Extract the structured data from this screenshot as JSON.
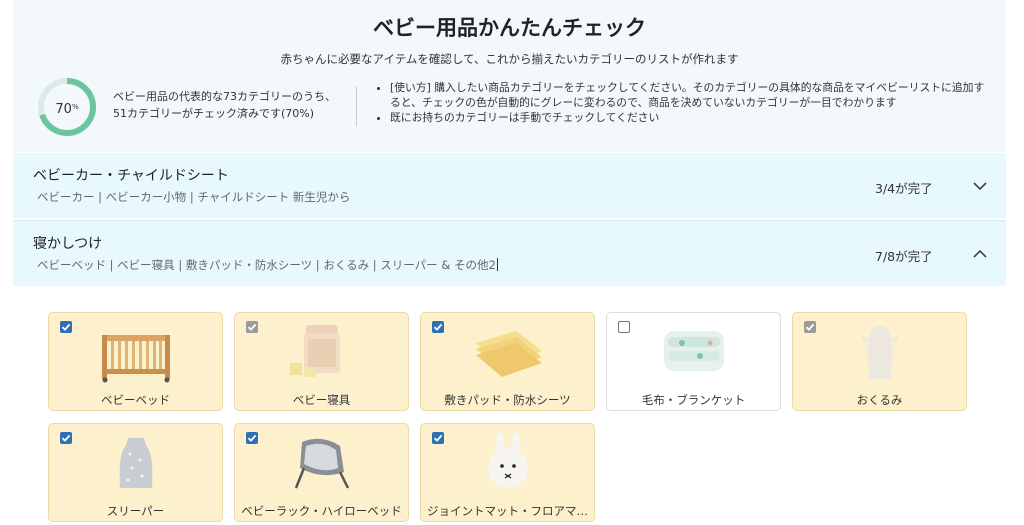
{
  "header": {
    "title": "ベビー用品かんたんチェック",
    "subtitle": "赤ちゃんに必要なアイテムを確認して、これから揃えたいカテゴリーのリストが作れます",
    "progress_percent": 70,
    "progress_label": "70",
    "progress_unit": "%",
    "stats_line1": "ベビー用品の代表的な73カテゴリーのうち、",
    "stats_line2": "51カテゴリーがチェック済みです(70%)",
    "howto": [
      "[使い方] 購入したい商品カテゴリーをチェックしてください。そのカテゴリーの具体的な商品をマイベビーリストに追加すると、チェックの色が自動的にグレーに変わるので、商品を決めていないカテゴリーが一目でわかります",
      "既にお持ちのカテゴリーは手動でチェックしてください"
    ]
  },
  "categories": [
    {
      "name": "ベビーカー・チャイルドシート",
      "subs": "ベビーカー | ベビーカー小物 | チャイルドシート 新生児から",
      "progress": "3/4が完了",
      "expanded": false
    },
    {
      "name": "寝かしつけ",
      "subs": "ベビーベッド | ベビー寝具 | 敷きパッド・防水シーツ | おくるみ | スリーパー & その他2",
      "progress": "7/8が完了",
      "expanded": true
    }
  ],
  "items": [
    {
      "label": "ベビーベッド",
      "state": "checked",
      "icon": "crib-icon"
    },
    {
      "label": "ベビー寝具",
      "state": "checked-grey",
      "icon": "bedding-set-icon"
    },
    {
      "label": "敷きパッド・防水シーツ",
      "state": "checked",
      "icon": "pad-icon"
    },
    {
      "label": "毛布・ブランケット",
      "state": "unchecked",
      "icon": "blanket-icon"
    },
    {
      "label": "おくるみ",
      "state": "checked-grey",
      "icon": "swaddle-icon"
    },
    {
      "label": "スリーパー",
      "state": "checked",
      "icon": "sleeper-icon"
    },
    {
      "label": "ベビーラック・ハイローベッド",
      "state": "checked",
      "icon": "baby-rack-icon"
    },
    {
      "label": "ジョイントマット・フロアマ…",
      "state": "checked",
      "icon": "joint-mat-icon"
    }
  ],
  "colors": {
    "header_bg": "#f2f8fc",
    "category_bg": "#e8f9fd",
    "card_checked_bg": "#fdf1cd",
    "checkbox_blue": "#2f6fb5",
    "checkbox_grey": "#9a9a9a",
    "ring_green": "#6cc4a0"
  }
}
